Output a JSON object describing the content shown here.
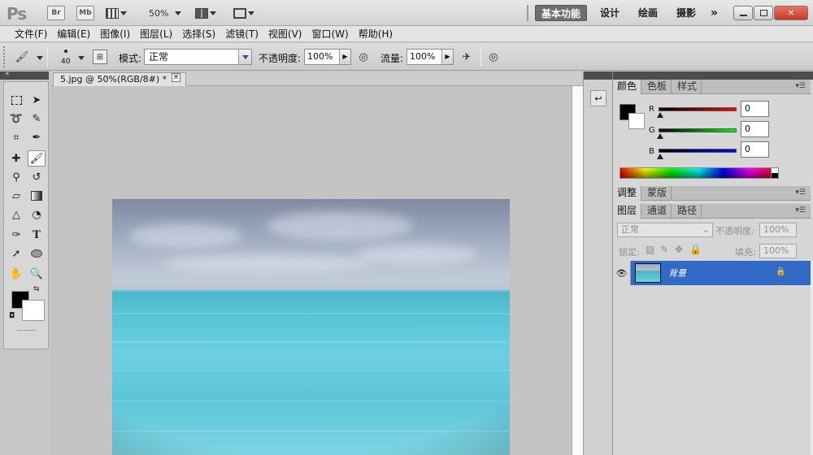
{
  "appbar": {
    "logo": "Ps",
    "bridge": "Br",
    "minibridge": "Mb",
    "zoom": "50%",
    "workspaces": [
      "基本功能",
      "设计",
      "绘画",
      "摄影"
    ],
    "more": "»"
  },
  "menu": [
    "文件(F)",
    "编辑(E)",
    "图像(I)",
    "图层(L)",
    "选择(S)",
    "滤镜(T)",
    "视图(V)",
    "窗口(W)",
    "帮助(H)"
  ],
  "options": {
    "brush_size": "40",
    "mode_label": "模式:",
    "mode_value": "正常",
    "opacity_label": "不透明度:",
    "opacity_value": "100%",
    "flow_label": "流量:",
    "flow_value": "100%"
  },
  "document": {
    "tab_title": "5.jpg @ 50%(RGB/8#) *",
    "close": "×"
  },
  "color_panel": {
    "tabs": [
      "颜色",
      "色板",
      "样式"
    ],
    "channels": [
      {
        "label": "R",
        "value": "0",
        "gradient_end": "#ff0000"
      },
      {
        "label": "G",
        "value": "0",
        "gradient_end": "#00ff00"
      },
      {
        "label": "B",
        "value": "0",
        "gradient_end": "#0000ff"
      }
    ],
    "foreground": "#000000",
    "background": "#ffffff"
  },
  "adjust_panel": {
    "tabs": [
      "调整",
      "蒙版"
    ]
  },
  "layers_panel": {
    "tabs": [
      "图层",
      "通道",
      "路径"
    ],
    "blend_mode": "正常",
    "opacity_label": "不透明度:",
    "opacity_value": "100%",
    "lock_label": "锁定:",
    "fill_label": "填充:",
    "fill_value": "100%",
    "layers": [
      {
        "name": "背景",
        "visible": true,
        "locked": true,
        "selected": true
      }
    ]
  },
  "colors": {
    "accent": "#3169c6",
    "ui_bg": "#d6d6d6",
    "dark_strip": "#4c4c4c"
  }
}
